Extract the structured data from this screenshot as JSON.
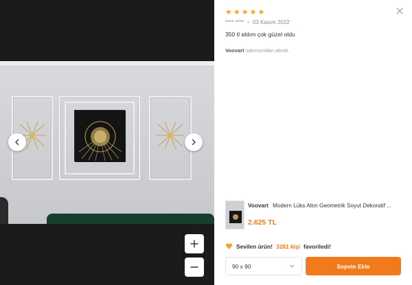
{
  "viewer": {
    "image_alt": "Review photo",
    "prev_icon": "chevron-left-icon",
    "next_icon": "chevron-right-icon",
    "zoom_in_icon": "plus-icon",
    "zoom_out_icon": "minus-icon"
  },
  "review": {
    "rating": 5,
    "stars": [
      "★",
      "★",
      "★",
      "★",
      "★"
    ],
    "star_color": "#f5a623",
    "reviewer": "**** ****",
    "separator": "•",
    "date": "03 Kasım 2022",
    "comment": "350 tl aldım çok güzel oldu",
    "seller_name": "Voovart",
    "seller_suffix": "satıcısından alındı."
  },
  "product": {
    "brand": "Voovart",
    "title": "Modern Lüks Altın Geometrik Soyut Dekoratif ...",
    "price": "2.625 TL"
  },
  "favorite": {
    "prefix": "Sevilen ürün!",
    "count": "3281 kişi",
    "suffix": "favoriledi!"
  },
  "actions": {
    "size_value": "90 x 90",
    "add_to_cart": "Sepete Ekle"
  },
  "colors": {
    "accent": "#f27a1a",
    "star": "#f5a623",
    "viewer_bg": "#1b1b1b"
  }
}
